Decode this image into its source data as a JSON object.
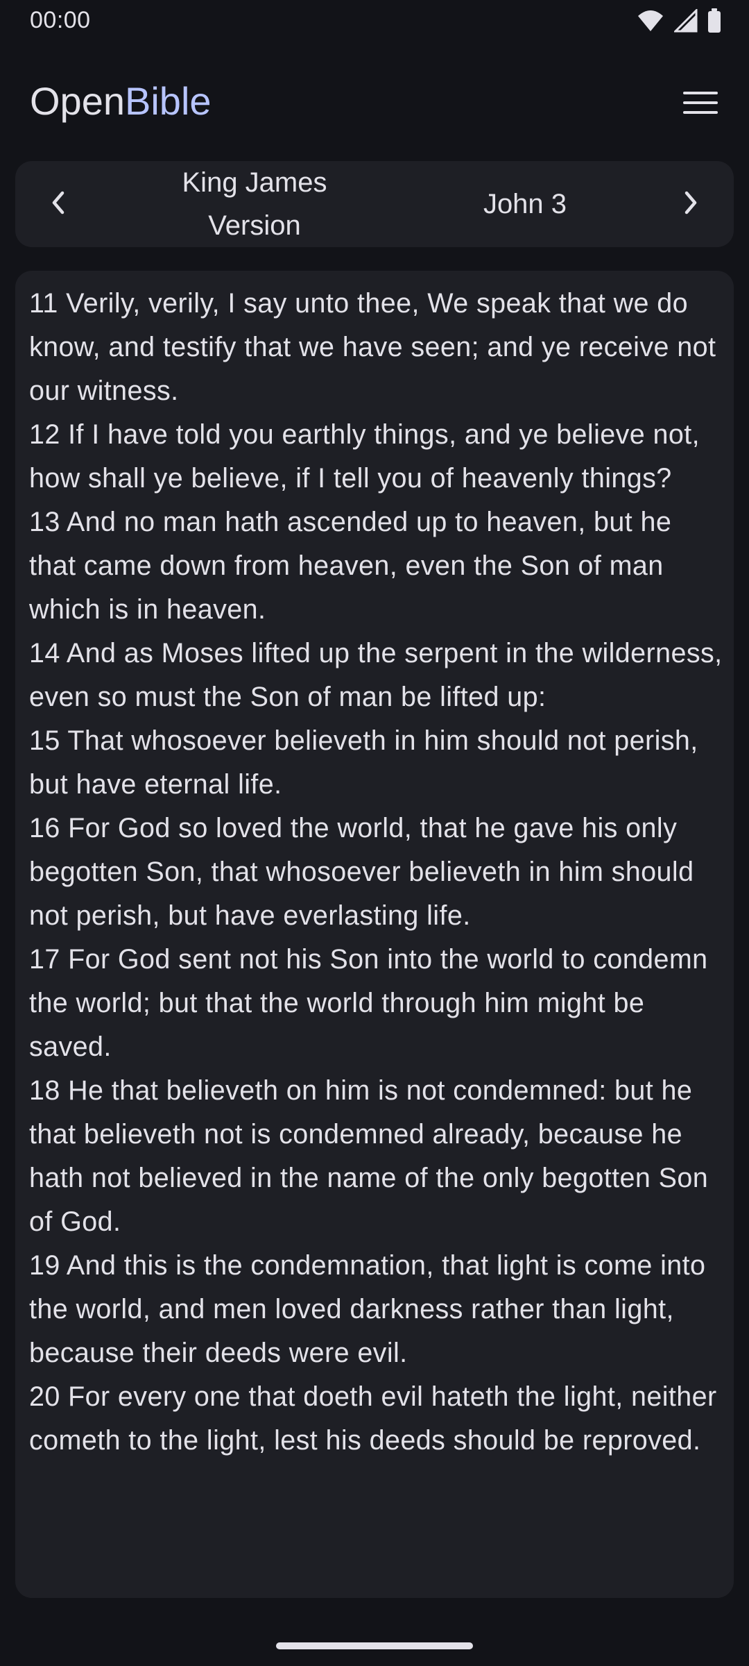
{
  "status_bar": {
    "time": "00:00",
    "icons": [
      "wifi-icon",
      "signal-icon",
      "battery-icon"
    ]
  },
  "header": {
    "title_part1": "Open",
    "title_part2": "Bible",
    "menu_icon": "hamburger-menu-icon"
  },
  "navigation": {
    "prev_icon": "chevron-left-icon",
    "version_label": "King James Version",
    "chapter_label": "John 3",
    "next_icon": "chevron-right-icon"
  },
  "verses": [
    "11 Verily, verily, I say unto thee, We speak that we do know, and testify that we have seen; and ye receive not our witness.",
    "12 If I have told you earthly things, and ye believe not, how shall ye believe, if I tell you of heavenly things?",
    "13 And no man hath ascended up to heaven, but he that came down from heaven, even the Son of man which is in heaven.",
    "14 And as Moses lifted up the serpent in the wilderness, even so must the Son of man be lifted up:",
    "15 That whosoever believeth in him should not perish, but have eternal life.",
    "16 For God so loved the world, that he gave his only begotten Son, that whosoever believeth in him should not perish, but have everlasting life.",
    "17 For God sent not his Son into the world to condemn the world; but that the world through him might be saved.",
    "18 He that believeth on him is not condemned: but he that believeth not is condemned already, because he hath not believed in the name of the only begotten Son of God.",
    "19 And this is the condemnation, that light is come into the world, and men loved darkness rather than light, because their deeds were evil.",
    "20 For every one that doeth evil hateth the light, neither cometh to the light, lest his deeds should be reproved."
  ],
  "colors": {
    "background": "#121318",
    "card": "#1e1f25",
    "text": "#e3e2e9",
    "accent": "#b7c4ff"
  }
}
